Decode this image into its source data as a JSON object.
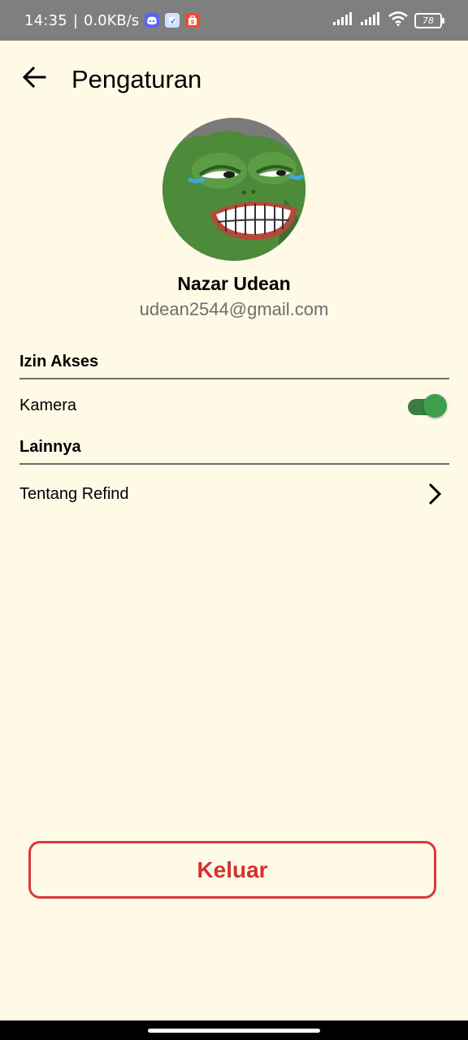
{
  "status_bar": {
    "time": "14:35",
    "separator": "|",
    "net_speed": "0.0KB/s",
    "apps": [
      "discord-icon",
      "app-icon",
      "shopee-icon"
    ],
    "battery": "78"
  },
  "header": {
    "title": "Pengaturan",
    "back_icon": "arrow-left-icon"
  },
  "profile": {
    "name": "Nazar Udean",
    "email": "udean2544@gmail.com",
    "avatar": "pepe-frog-avatar"
  },
  "sections": {
    "permissions": {
      "title": "Izin Akses",
      "items": [
        {
          "label": "Kamera",
          "enabled": true
        }
      ]
    },
    "others": {
      "title": "Lainnya",
      "items": [
        {
          "label": "Tentang Refind",
          "icon": "chevron-right-icon"
        }
      ]
    }
  },
  "logout": {
    "label": "Keluar"
  },
  "colors": {
    "background": "#fffae6",
    "accent_green": "#3e9e4d",
    "danger_red": "#d33232",
    "muted_text": "#6e6e6e"
  }
}
